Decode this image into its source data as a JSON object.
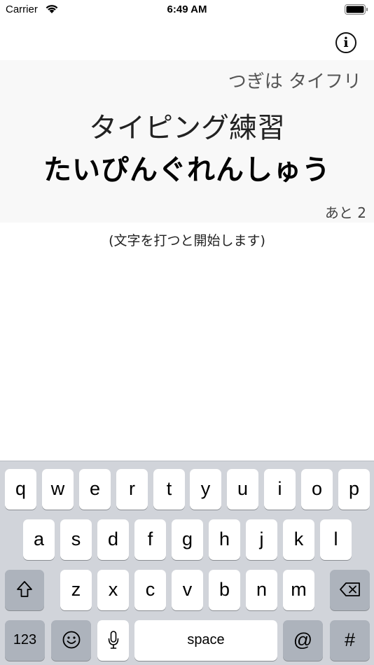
{
  "status_bar": {
    "carrier": "Carrier",
    "time": "6:49 AM"
  },
  "info_button": {
    "label": "i"
  },
  "prompt": {
    "next_label": "つぎは タイフリ",
    "phrase_kanji": "タイピング練習",
    "phrase_kana": "たいぴんぐれんしゅう",
    "remaining_label": "あと 2"
  },
  "hint": "(文字を打つと開始します)",
  "keyboard": {
    "row1": [
      "q",
      "w",
      "e",
      "r",
      "t",
      "y",
      "u",
      "i",
      "o",
      "p"
    ],
    "row2": [
      "a",
      "s",
      "d",
      "f",
      "g",
      "h",
      "j",
      "k",
      "l"
    ],
    "row3": [
      "z",
      "x",
      "c",
      "v",
      "b",
      "n",
      "m"
    ],
    "row4": {
      "numbers": "123",
      "space": "space",
      "at": "@",
      "hash": "#"
    },
    "icons": {
      "shift": "shift-icon",
      "delete": "delete-icon",
      "emoji": "emoji-icon",
      "mic": "microphone-icon"
    }
  }
}
